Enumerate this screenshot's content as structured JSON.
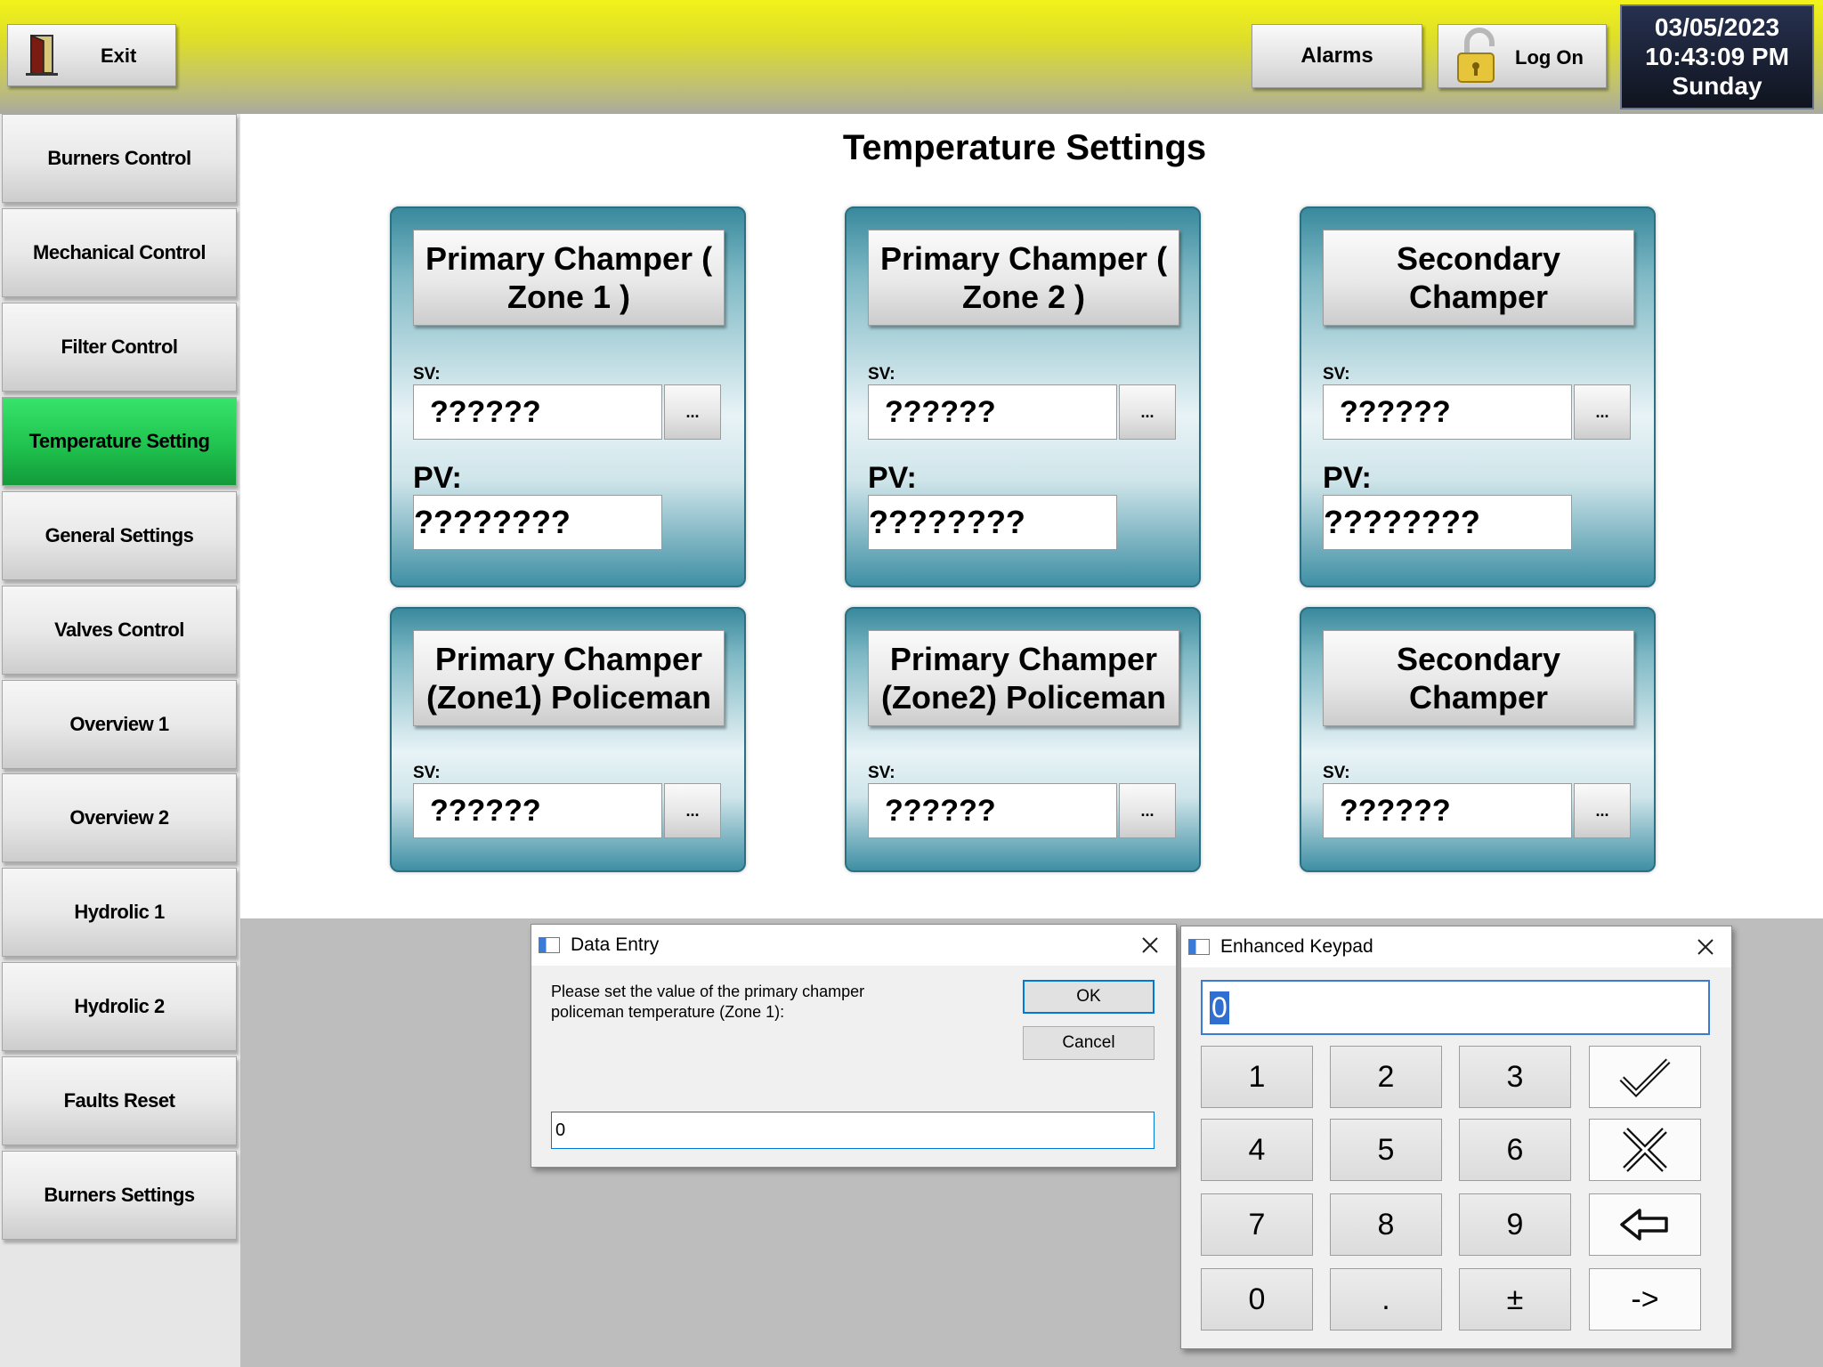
{
  "topbar": {
    "exit_label": "Exit",
    "alarms_label": "Alarms",
    "logon_label": "Log On",
    "date": "03/05/2023",
    "time": "10:43:09 PM",
    "day": "Sunday"
  },
  "sidebar": {
    "items": [
      {
        "label": "Burners Control"
      },
      {
        "label": "Mechanical Control"
      },
      {
        "label": "Filter Control"
      },
      {
        "label": "Temperature Setting"
      },
      {
        "label": "General Settings"
      },
      {
        "label": "Valves Control"
      },
      {
        "label": "Overview 1"
      },
      {
        "label": "Overview 2"
      },
      {
        "label": "Hydrolic 1"
      },
      {
        "label": "Hydrolic 2"
      },
      {
        "label": "Faults Reset"
      },
      {
        "label": "Burners Settings"
      }
    ],
    "active_color": "#20c34f"
  },
  "main": {
    "title": "Temperature Settings",
    "cards": [
      {
        "title": "Primary Champer ( Zone 1 )",
        "sv_label": "SV:",
        "sv_value": "??????",
        "browse_label": "...",
        "pv_label": "PV:",
        "pv_value": "????????"
      },
      {
        "title": "Primary Champer ( Zone 2 )",
        "sv_label": "SV:",
        "sv_value": "??????",
        "browse_label": "...",
        "pv_label": "PV:",
        "pv_value": "????????"
      },
      {
        "title": "Secondary Champer",
        "sv_label": "SV:",
        "sv_value": "??????",
        "browse_label": "...",
        "pv_label": "PV:",
        "pv_value": "????????"
      },
      {
        "title": "Primary Champer (Zone1) Policeman",
        "sv_label": "SV:",
        "sv_value": "??????",
        "browse_label": "..."
      },
      {
        "title": "Primary Champer (Zone2) Policeman",
        "sv_label": "SV:",
        "sv_value": "??????",
        "browse_label": "..."
      },
      {
        "title": "Secondary Champer",
        "sv_label": "SV:",
        "sv_value": "??????",
        "browse_label": "..."
      }
    ]
  },
  "data_entry": {
    "title": "Data Entry",
    "message": "Please set the value of the primary champer policeman temperature (Zone 1):",
    "ok_label": "OK",
    "cancel_label": "Cancel",
    "input_value": "0"
  },
  "keypad": {
    "title": "Enhanced Keypad",
    "display_value": "0",
    "keys": {
      "k1": "1",
      "k2": "2",
      "k3": "3",
      "k4": "4",
      "k5": "5",
      "k6": "6",
      "k7": "7",
      "k8": "8",
      "k9": "9",
      "k0": "0",
      "dot": ".",
      "plusminus": "±",
      "arrow": "->"
    },
    "icons": {
      "enter": "check-icon",
      "cancel": "x-icon",
      "backspace": "backspace-arrow-icon"
    }
  }
}
